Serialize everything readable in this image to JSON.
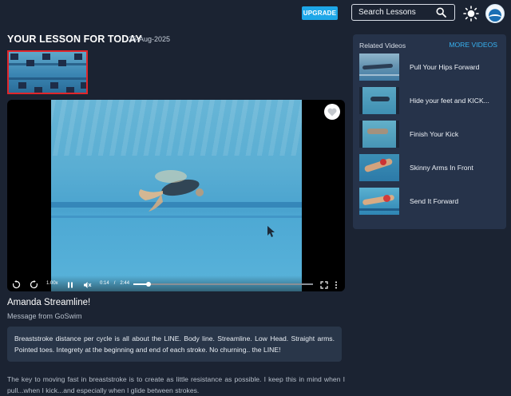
{
  "header": {
    "upgrade_label": "UPGRADE",
    "search_placeholder": "Search Lessons",
    "icons": [
      "search-icon",
      "sun-icon",
      "avatar"
    ]
  },
  "lesson": {
    "title": "YOUR LESSON FOR TODAY",
    "date": "26-Aug-2025"
  },
  "player": {
    "speed": "1.00x",
    "current_time": "0:14",
    "separator": "/",
    "duration": "2:44",
    "progress_fraction": 0.085
  },
  "video": {
    "title": "Amanda Streamline!",
    "message_from": "Message from GoSwim",
    "note": "Breaststroke distance per cycle is all about the LINE. Body line. Streamline. Low Head. Straight arms. Pointed toes. Integrety at the beginning and end of each stroke. No churning.. the LINE!",
    "body": "The key to moving fast in breaststroke is to create as little resistance as possible. I keep this in mind when I pull...when I kick...and especially when I glide between strokes."
  },
  "related": {
    "title": "Related Videos",
    "more_label": "MORE VIDEOS",
    "items": [
      {
        "label": "Pull Your Hips Forward"
      },
      {
        "label": "Hide your feet and KICK..."
      },
      {
        "label": "Finish Your Kick"
      },
      {
        "label": "Skinny Arms In Front"
      },
      {
        "label": "Send It Forward"
      }
    ]
  },
  "colors": {
    "background": "#1b2332",
    "accent": "#1ea7e8",
    "panel": "#26334a",
    "thumb_border": "#e0262b"
  }
}
